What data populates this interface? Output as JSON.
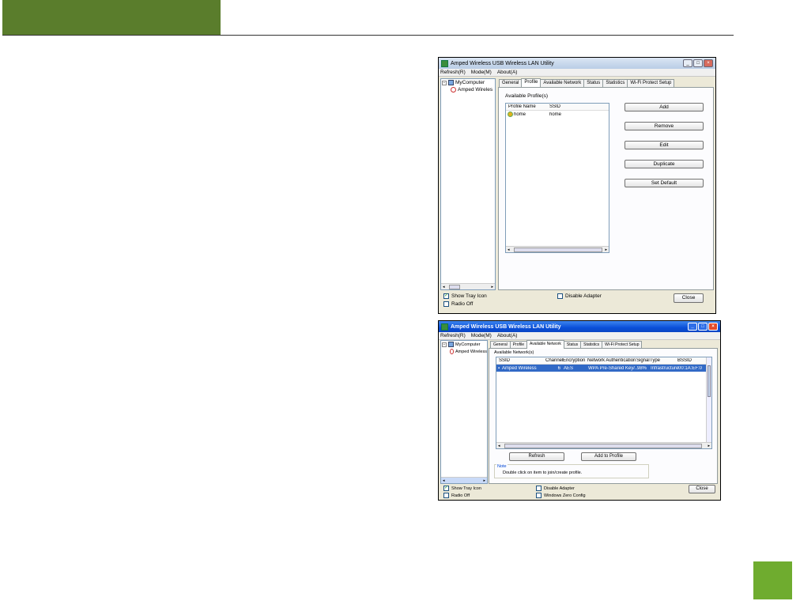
{
  "colors": {
    "page_tab": "#5a7d2c",
    "page_square": "#6fac2f",
    "xp_title": "#0a4fd8",
    "selection": "#3169c6"
  },
  "window1": {
    "title": "Amped Wireless USB Wireless LAN Utility",
    "menu": [
      "Refresh(R)",
      "Mode(M)",
      "About(A)"
    ],
    "tree": {
      "root": "MyComputer",
      "child": "Amped Wireles"
    },
    "tabs": [
      "General",
      "Profile",
      "Available Network",
      "Status",
      "Statistics",
      "Wi-Fi Protect Setup"
    ],
    "active_tab": "Profile",
    "section_label": "Available Profile(s)",
    "profile_columns": [
      "Profile Name",
      "SSID"
    ],
    "profiles": [
      {
        "name": "home",
        "ssid": "home"
      }
    ],
    "buttons": {
      "add": "Add",
      "remove": "Remove",
      "edit": "Edit",
      "duplicate": "Duplicate",
      "set_default": "Set Default",
      "close": "Close"
    },
    "checkboxes": {
      "show_tray_icon": "Show Tray Icon",
      "radio_off": "Radio Off",
      "disable_adapter": "Disable Adapter"
    },
    "show_tray_checked": true
  },
  "window2": {
    "title": "Amped Wireless USB Wireless LAN Utility",
    "menu": [
      "Refresh(R)",
      "Mode(M)",
      "About(A)"
    ],
    "tree": {
      "root": "MyComputer",
      "child": "Amped Wireless"
    },
    "tabs": [
      "General",
      "Profile",
      "Available Network",
      "Status",
      "Statistics",
      "Wi-Fi Protect Setup"
    ],
    "active_tab": "Available Network",
    "section_label": "Available Network(s)",
    "network_columns": [
      "SSID",
      "Channel",
      "Encryption",
      "Network Authentication",
      "Signal",
      "Type",
      "BSSID"
    ],
    "networks": [
      {
        "ssid": "Amped Wireless",
        "channel": "6",
        "encryption": "AES",
        "auth": "WPA Pre-Shared Key/...",
        "signal": "98%",
        "type": "Infrastructure",
        "bssid": "00:1A:EF:00"
      }
    ],
    "buttons": {
      "refresh": "Refresh",
      "add_to_profile": "Add to Profile",
      "close": "Close"
    },
    "note_title": "Note",
    "note_text": "Double click on item to join/create profile.",
    "checkboxes": {
      "show_tray_icon": "Show Tray Icon",
      "radio_off": "Radio Off",
      "disable_adapter": "Disable Adapter",
      "windows_zero_config": "Windows Zero Config"
    },
    "show_tray_checked": true
  }
}
